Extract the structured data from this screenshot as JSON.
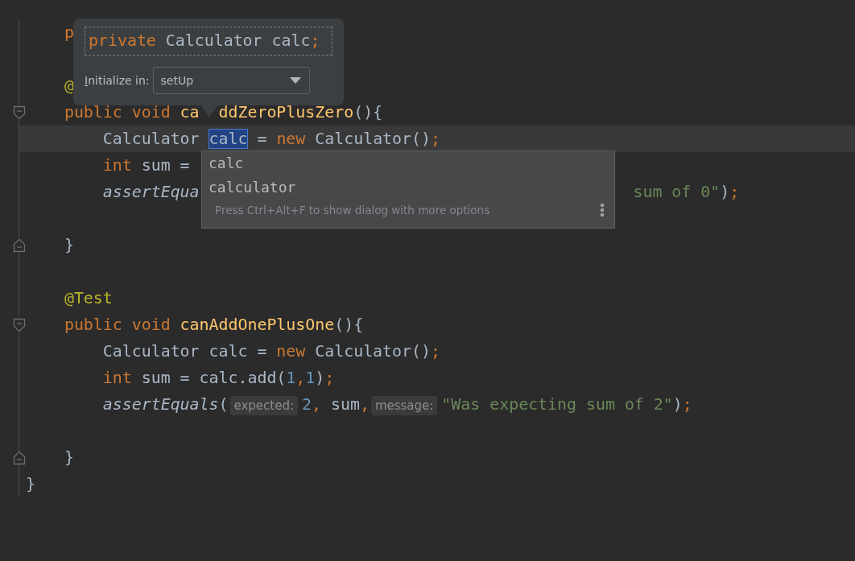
{
  "editor": {
    "lines": [
      {
        "kind": "plain",
        "current": false,
        "tokens": [
          {
            "kind": "keyword",
            "text": "    p"
          }
        ]
      },
      {
        "kind": "plain",
        "current": false
      },
      {
        "kind": "plain",
        "current": false,
        "tokens": [
          {
            "kind": "annotation",
            "text": "    @"
          }
        ]
      },
      {
        "kind": "fold_start",
        "current": false,
        "tokens": [
          {
            "kind": "keyword",
            "text": "    public void "
          },
          {
            "kind": "method",
            "text": "ca"
          },
          {
            "kind": "method",
            "text": "ddZeroPlusZero",
            "after_cover": true
          },
          {
            "kind": "plain",
            "text": "(){"
          }
        ]
      },
      {
        "kind": "plain",
        "current": true,
        "tokens": [
          {
            "kind": "plain",
            "text": "        Calculator "
          },
          {
            "kind": "selected",
            "text": "calc"
          },
          {
            "kind": "plain",
            "text": " = "
          },
          {
            "kind": "keyword",
            "text": "new"
          },
          {
            "kind": "plain",
            "text": " Calculator()"
          },
          {
            "kind": "punct",
            "text": ";"
          }
        ]
      },
      {
        "kind": "plain",
        "current": false,
        "tokens": [
          {
            "kind": "keyword",
            "text": "        int"
          },
          {
            "kind": "plain",
            "text": " sum = "
          }
        ]
      },
      {
        "kind": "plain",
        "current": false,
        "tokens": [
          {
            "kind": "italic",
            "text": "        assertEqua"
          },
          {
            "kind": "string",
            "text": "sum of 0\"",
            "after_cover": true
          },
          {
            "kind": "plain",
            "text": ")"
          },
          {
            "kind": "punct",
            "text": ";"
          }
        ]
      },
      {
        "kind": "plain",
        "current": false
      },
      {
        "kind": "fold_end",
        "current": false,
        "tokens": [
          {
            "kind": "plain",
            "text": "    }"
          }
        ]
      },
      {
        "kind": "plain",
        "current": false
      },
      {
        "kind": "plain",
        "current": false,
        "tokens": [
          {
            "kind": "annotation",
            "text": "    @Test"
          }
        ]
      },
      {
        "kind": "fold_start",
        "current": false,
        "tokens": [
          {
            "kind": "keyword",
            "text": "    public void "
          },
          {
            "kind": "method",
            "text": "canAddOnePlusOne"
          },
          {
            "kind": "plain",
            "text": "(){"
          }
        ]
      },
      {
        "kind": "plain",
        "current": false,
        "tokens": [
          {
            "kind": "plain",
            "text": "        Calculator calc = "
          },
          {
            "kind": "keyword",
            "text": "new"
          },
          {
            "kind": "plain",
            "text": " Calculator()"
          },
          {
            "kind": "punct",
            "text": ";"
          }
        ]
      },
      {
        "kind": "plain",
        "current": false,
        "tokens": [
          {
            "kind": "keyword",
            "text": "        int"
          },
          {
            "kind": "plain",
            "text": " sum = calc.add("
          },
          {
            "kind": "number",
            "text": "1"
          },
          {
            "kind": "punct",
            "text": ","
          },
          {
            "kind": "number",
            "text": "1"
          },
          {
            "kind": "plain",
            "text": ")"
          },
          {
            "kind": "punct",
            "text": ";"
          }
        ]
      },
      {
        "kind": "plain",
        "current": false,
        "tokens": [
          {
            "kind": "italic",
            "text": "        assertEquals"
          },
          {
            "kind": "plain",
            "text": "("
          },
          {
            "kind": "hint",
            "text": "expected:"
          },
          {
            "kind": "number",
            "text": "2"
          },
          {
            "kind": "punct",
            "text": ","
          },
          {
            "kind": "plain",
            "text": " sum"
          },
          {
            "kind": "punct",
            "text": ","
          },
          {
            "kind": "hint",
            "text": "message:"
          },
          {
            "kind": "string",
            "text": "\"Was expecting sum of 2\""
          },
          {
            "kind": "plain",
            "text": ")"
          },
          {
            "kind": "punct",
            "text": ";"
          }
        ]
      },
      {
        "kind": "plain",
        "current": false
      },
      {
        "kind": "fold_end",
        "current": false,
        "tokens": [
          {
            "kind": "plain",
            "text": "    }"
          }
        ]
      },
      {
        "kind": "plain",
        "current": false,
        "tokens": [
          {
            "kind": "plain",
            "text": "}"
          }
        ]
      }
    ]
  },
  "field_popup": {
    "declaration": [
      {
        "kind": "keyword",
        "text": "private "
      },
      {
        "kind": "plain",
        "text": "Calculator calc"
      },
      {
        "kind": "punct",
        "text": ";"
      }
    ],
    "label": "Initialize in:",
    "dropdown": {
      "value": "setUp"
    }
  },
  "completion": {
    "items": [
      {
        "label": "calc"
      },
      {
        "label": "calculator"
      }
    ],
    "hint": "Press Ctrl+Alt+F to show dialog with more options"
  }
}
